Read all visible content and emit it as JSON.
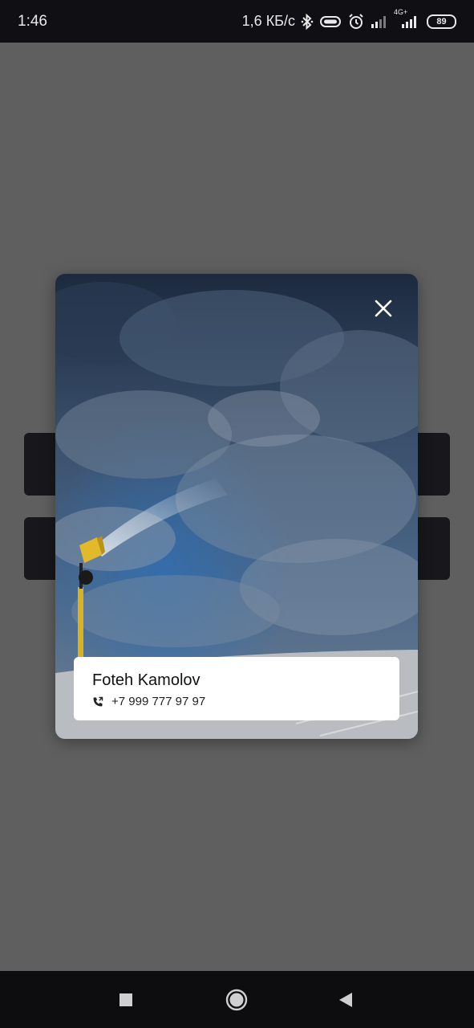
{
  "status_bar": {
    "time": "1:46",
    "network_speed": "1,6 КБ/с",
    "network_type": "4G+",
    "battery_level": "89",
    "icons": [
      "bluetooth-icon",
      "vibrate-icon",
      "alarm-icon",
      "signal-weak-icon",
      "signal-strong-icon",
      "battery-icon"
    ]
  },
  "modal": {
    "close_icon": "close-icon",
    "contact": {
      "name": "Foteh Kamolov",
      "phone_icon": "phone-call-icon",
      "phone": "+7 999 777 97 97"
    }
  },
  "nav_bar": {
    "icons": [
      "recents-square-icon",
      "home-circle-icon",
      "back-triangle-icon"
    ]
  },
  "colors": {
    "overlay": "#5f5f5f",
    "status_bar": "#101014",
    "nav_bar": "#0d0d10",
    "card": "#ffffff"
  }
}
